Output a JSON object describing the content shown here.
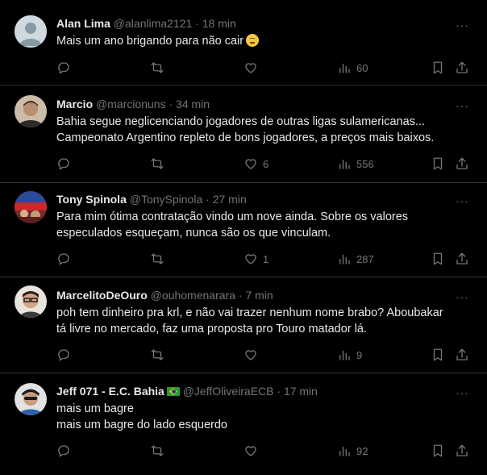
{
  "tweets": [
    {
      "name": "Alan Lima",
      "handle": "@alanlima2121",
      "time": "18 min",
      "lines": [
        "Mais um ano brigando para não cair"
      ],
      "emoji": "relieved-face",
      "likes": "",
      "views": "60",
      "verified_flag": false
    },
    {
      "name": "Marcio",
      "handle": "@marcionuns",
      "time": "34 min",
      "lines": [
        "Bahia segue neglicenciando jogadores de outras ligas sulamericanas...",
        "Campeonato Argentino repleto de bons jogadores, a preços mais baixos."
      ],
      "likes": "6",
      "views": "556"
    },
    {
      "name": "Tony Spinola",
      "handle": "@TonySpinola",
      "time": "27 min",
      "lines": [
        "Para mim ótima contratação vindo um nove ainda. Sobre os valores",
        "especulados esqueçam, nunca são os que vinculam."
      ],
      "likes": "1",
      "views": "287"
    },
    {
      "name": "MarcelitoDeOuro",
      "handle": "@ouhomenarara",
      "time": "7 min",
      "lines": [
        "poh tem dinheiro pra krl, e não vai trazer nenhum nome brabo? Aboubakar",
        "tá livre no mercado, faz uma proposta pro Touro matador lá."
      ],
      "likes": "",
      "views": "9"
    },
    {
      "name": "Jeff 071 - E.C. Bahia",
      "handle": "@JeffOliveiraECB",
      "time": "17 min",
      "lines": [
        "mais um bagre",
        "mais um bagre do lado esquerdo"
      ],
      "likes": "",
      "views": "92",
      "flag": "brazil-flag"
    }
  ],
  "separator": "·",
  "more_glyph": "···",
  "colors": {
    "background": "#000000",
    "text": "#e7e9ea",
    "muted": "#71767b",
    "border": "#2f3336"
  }
}
